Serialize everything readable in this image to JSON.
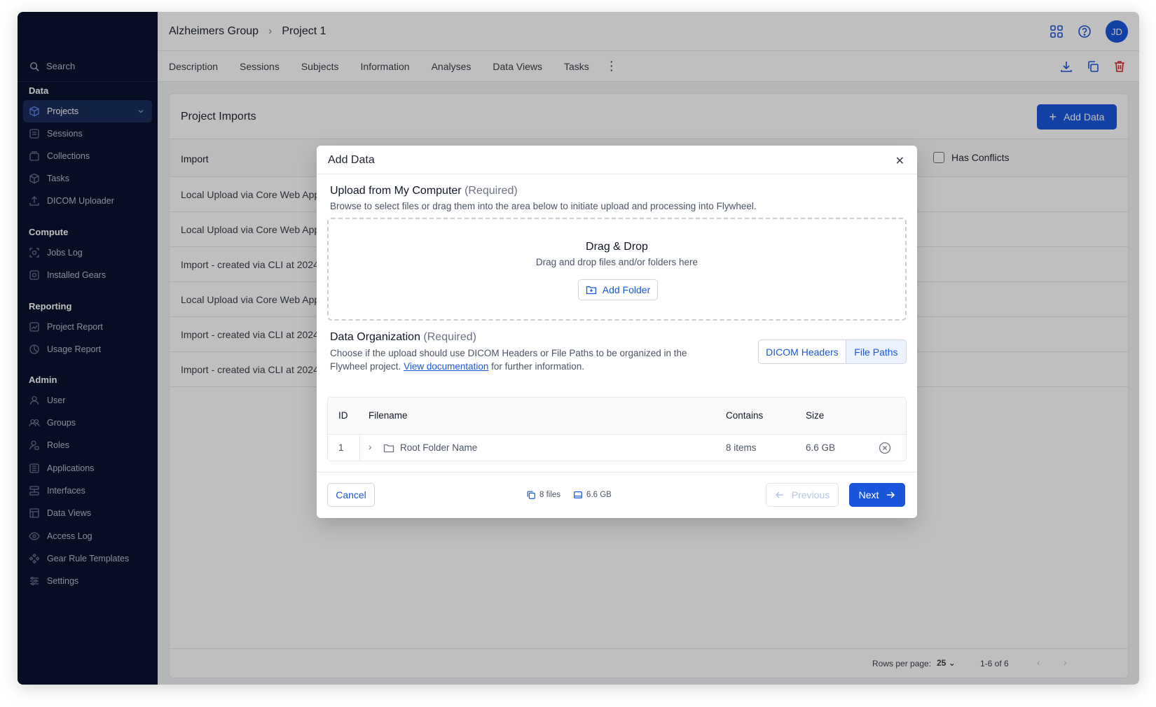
{
  "sidebar": {
    "search_label": "Search",
    "sections": [
      {
        "title": "Data",
        "items": [
          {
            "label": "Projects",
            "icon": "cube-icon",
            "active": true
          },
          {
            "label": "Sessions",
            "icon": "session-icon"
          },
          {
            "label": "Collections",
            "icon": "collection-icon"
          },
          {
            "label": "Tasks",
            "icon": "task-cube-icon"
          },
          {
            "label": "DICOM Uploader",
            "icon": "upload-icon"
          }
        ]
      },
      {
        "title": "Compute",
        "items": [
          {
            "label": "Jobs Log",
            "icon": "jobs-icon"
          },
          {
            "label": "Installed Gears",
            "icon": "gear-icon"
          }
        ]
      },
      {
        "title": "Reporting",
        "items": [
          {
            "label": "Project Report",
            "icon": "report-icon"
          },
          {
            "label": "Usage Report",
            "icon": "pie-icon"
          }
        ]
      },
      {
        "title": "Admin",
        "items": [
          {
            "label": "User",
            "icon": "user-icon"
          },
          {
            "label": "Groups",
            "icon": "users-icon"
          },
          {
            "label": "Roles",
            "icon": "role-icon"
          },
          {
            "label": "Applications",
            "icon": "apps-icon"
          },
          {
            "label": "Interfaces",
            "icon": "interface-icon"
          },
          {
            "label": "Data Views",
            "icon": "table-icon"
          },
          {
            "label": "Access Log",
            "icon": "eye-icon"
          },
          {
            "label": "Gear Rule Templates",
            "icon": "rule-icon"
          },
          {
            "label": "Settings",
            "icon": "sliders-icon"
          }
        ]
      }
    ]
  },
  "header": {
    "breadcrumb_group": "Alzheimers Group",
    "breadcrumb_project": "Project 1",
    "avatar_initials": "JD"
  },
  "tabs": [
    "Description",
    "Sessions",
    "Subjects",
    "Information",
    "Analyses",
    "Data Views",
    "Tasks"
  ],
  "card": {
    "title": "Project Imports",
    "add_data_label": "Add Data",
    "col_import": "Import",
    "has_conflicts_label": "Has Conflicts",
    "rows": [
      "Local Upload via Core Web App...",
      "Local Upload via Core Web App...",
      "Import - created via CLI at 2024...",
      "Local Upload via Core Web App...",
      "Import - created via CLI at 2024...",
      "Import - created via CLI at 2024..."
    ],
    "rows_per_page_label": "Rows per page:",
    "rows_per_page_value": "25",
    "range_label": "1-6 of 6"
  },
  "modal": {
    "title": "Add Data",
    "upload_title": "Upload from My Computer",
    "upload_required": "(Required)",
    "upload_desc": "Browse to select files or drag them into the area below to initiate upload and processing into Flywheel.",
    "dz_title": "Drag & Drop",
    "dz_sub": "Drag and drop files and/or folders here",
    "add_folder_label": "Add Folder",
    "org_title": "Data Organization",
    "org_required": "(Required)",
    "org_desc_1": "Choose if the upload should use DICOM Headers or File Paths to be organized in the",
    "org_desc_2_pre": "Flywheel project.",
    "org_desc_link": "View documentation",
    "org_desc_2_post": "for further information.",
    "seg_options": [
      "DICOM Headers",
      "File Paths"
    ],
    "seg_selected": "File Paths",
    "table": {
      "headers": [
        "ID",
        "Filename",
        "Contains",
        "Size"
      ],
      "rows": [
        {
          "id": "1",
          "filename": "Root Folder Name",
          "contains": "8 items",
          "size": "6.6 GB"
        }
      ]
    },
    "cancel_label": "Cancel",
    "files_count": "8 files",
    "total_size": "6.6 GB",
    "previous_label": "Previous",
    "next_label": "Next"
  },
  "colors": {
    "sidebar_bg": "#0a1330",
    "accent": "#1a56db",
    "danger": "#dc2626"
  }
}
